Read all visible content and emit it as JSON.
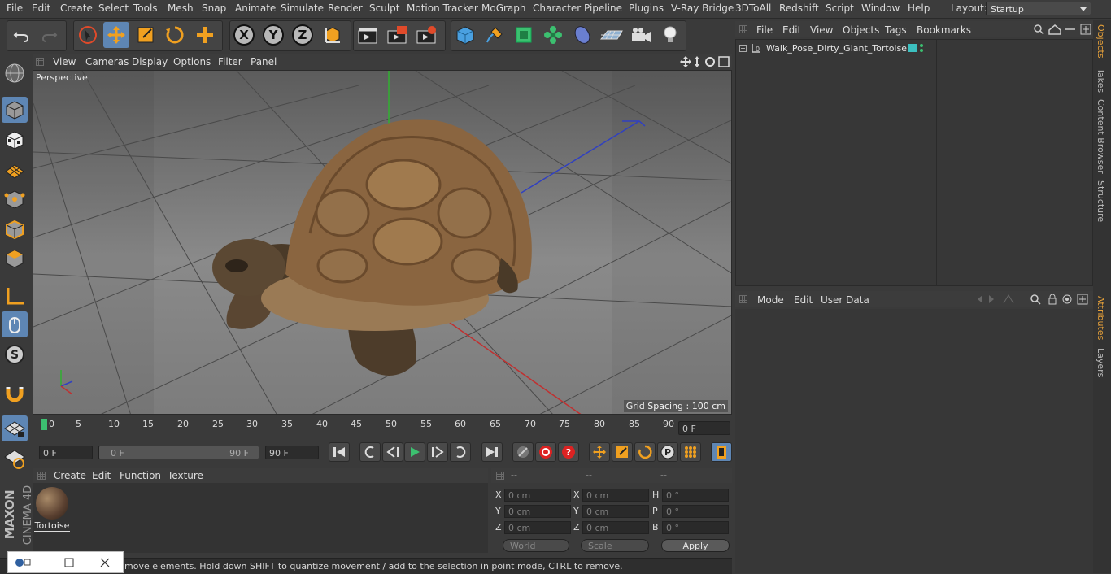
{
  "menubar": {
    "items": [
      "File",
      "Edit",
      "Create",
      "Select",
      "Tools",
      "Mesh",
      "Snap",
      "Animate",
      "Simulate",
      "Render",
      "Sculpt",
      "Motion Tracker",
      "MoGraph",
      "Character",
      "Pipeline",
      "Plugins",
      "V-Ray Bridge",
      "3DToAll",
      "Redshift",
      "Script",
      "Window",
      "Help"
    ],
    "layout_label": "Layout:",
    "layout_value": "Startup"
  },
  "viewport": {
    "menu": [
      "View",
      "Cameras",
      "Display",
      "Options",
      "Filter",
      "Panel"
    ],
    "camera_label": "Perspective",
    "grid_spacing": "Grid Spacing : 100 cm"
  },
  "timeline": {
    "ticks": [
      "0",
      "5",
      "10",
      "15",
      "20",
      "25",
      "30",
      "35",
      "40",
      "45",
      "50",
      "55",
      "60",
      "65",
      "70",
      "75",
      "80",
      "85",
      "90"
    ],
    "current_frame_field": "0 F",
    "start_field": "0 F",
    "range_start": "0 F",
    "range_end": "90 F",
    "end_field": "90 F"
  },
  "materials": {
    "menu": [
      "Create",
      "Edit",
      "Function",
      "Texture"
    ],
    "items": [
      {
        "name": "Tortoise"
      }
    ]
  },
  "coordinates": {
    "headers": [
      "--",
      "--",
      "--"
    ],
    "rows": [
      {
        "a": "X",
        "av": "0 cm",
        "b": "X",
        "bv": "0 cm",
        "c": "H",
        "cv": "0 °"
      },
      {
        "a": "Y",
        "av": "0 cm",
        "b": "Y",
        "bv": "0 cm",
        "c": "P",
        "cv": "0 °"
      },
      {
        "a": "Z",
        "av": "0 cm",
        "b": "Z",
        "bv": "0 cm",
        "c": "B",
        "cv": "0 °"
      }
    ],
    "mode_select": "World",
    "scale_select": "Scale",
    "apply_label": "Apply"
  },
  "status": {
    "text": "move elements. Hold down SHIFT to quantize movement / add to the selection in point mode, CTRL to remove."
  },
  "objects": {
    "menu": [
      "File",
      "Edit",
      "View",
      "Objects",
      "Tags",
      "Bookmarks"
    ],
    "tree": [
      {
        "name": "Walk_Pose_Dirty_Giant_Tortoise",
        "badge": "L0"
      }
    ]
  },
  "attributes": {
    "menu": [
      "Mode",
      "Edit",
      "User Data"
    ]
  },
  "right_tabs": {
    "top": [
      "Objects",
      "Takes",
      "Content Browser",
      "Structure"
    ],
    "bottom": [
      "Attributes",
      "Layers"
    ]
  },
  "branding": {
    "vendor": "MAXON",
    "product": "CINEMA 4D"
  },
  "colors": {
    "accent_blue": "#5e86b4",
    "tab_active": "#e8a23a",
    "axis_x": "#c03030",
    "axis_y": "#30b030",
    "axis_z": "#3040c0"
  }
}
